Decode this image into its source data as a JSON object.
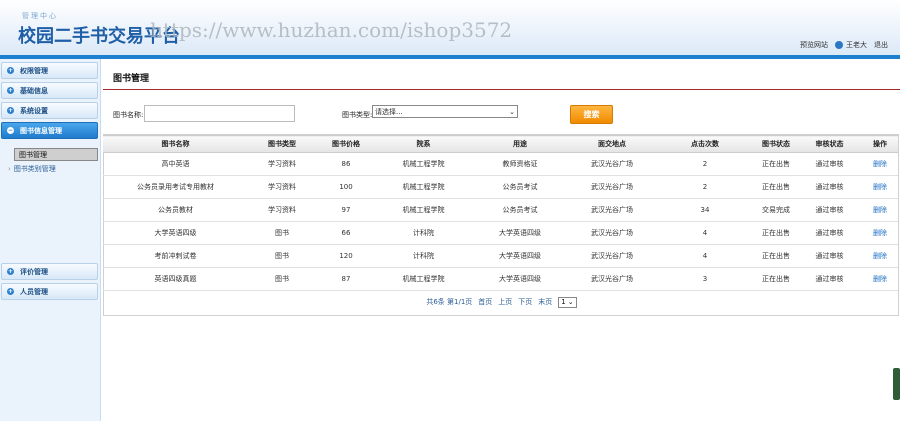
{
  "header": {
    "subtitle": "管理中心",
    "title": "校园二手书交易平台",
    "watermark": "https://www.huzhan.com/ishop3572",
    "links": {
      "preview": "预览网站",
      "user": "王老大",
      "logout": "退出"
    }
  },
  "sidebar": {
    "items": [
      {
        "label": "权限管理",
        "icon": "plus"
      },
      {
        "label": "基础信息",
        "icon": "plus"
      },
      {
        "label": "系统设置",
        "icon": "plus"
      },
      {
        "label": "图书信息管理",
        "icon": "minus",
        "active": true
      },
      {
        "label": "评价管理",
        "icon": "plus"
      },
      {
        "label": "人员管理",
        "icon": "plus"
      }
    ],
    "subitems": [
      {
        "label": "图书管理"
      },
      {
        "label": "图书类别管理"
      }
    ]
  },
  "main": {
    "title": "图书管理",
    "search": {
      "name_label": "图书名称:",
      "name_value": "",
      "type_label": "图书类型:",
      "type_selected": "请选择...",
      "button": "搜索"
    },
    "table": {
      "headers": [
        "图书名称",
        "图书类型",
        "图书价格",
        "院系",
        "用途",
        "面交地点",
        "点击次数",
        "图书状态",
        "审核状态",
        "操作"
      ],
      "rows": [
        [
          "高中英语",
          "学习资料",
          "86",
          "机械工程学院",
          "教师资格证",
          "武汉光谷广场",
          "2",
          "正在出售",
          "通过审核",
          "删除"
        ],
        [
          "公务员录用考试专用教材",
          "学习资料",
          "100",
          "机械工程学院",
          "公务员考试",
          "武汉光谷广场",
          "2",
          "正在出售",
          "通过审核",
          "删除"
        ],
        [
          "公务员教材",
          "学习资料",
          "97",
          "机械工程学院",
          "公务员考试",
          "武汉光谷广场",
          "34",
          "交易完成",
          "通过审核",
          "删除"
        ],
        [
          "大学英语四级",
          "图书",
          "66",
          "计科院",
          "大学英语四级",
          "武汉光谷广场",
          "4",
          "正在出售",
          "通过审核",
          "删除"
        ],
        [
          "考前冲刺试卷",
          "图书",
          "120",
          "计科院",
          "大学英语四级",
          "武汉光谷广场",
          "4",
          "正在出售",
          "通过审核",
          "删除"
        ],
        [
          "英语四级真题",
          "图书",
          "87",
          "机械工程学院",
          "大学英语四级",
          "武汉光谷广场",
          "3",
          "正在出售",
          "通过审核",
          "删除"
        ]
      ]
    },
    "pager": {
      "summary": "共6条 第1/1页",
      "first": "首页",
      "prev": "上页",
      "next": "下页",
      "last": "末页",
      "page": "1"
    }
  },
  "colors": {
    "accent": "#1c7fd0",
    "button": "#f39800",
    "link": "#1d6fc4",
    "title_line": "#a02a2a"
  }
}
